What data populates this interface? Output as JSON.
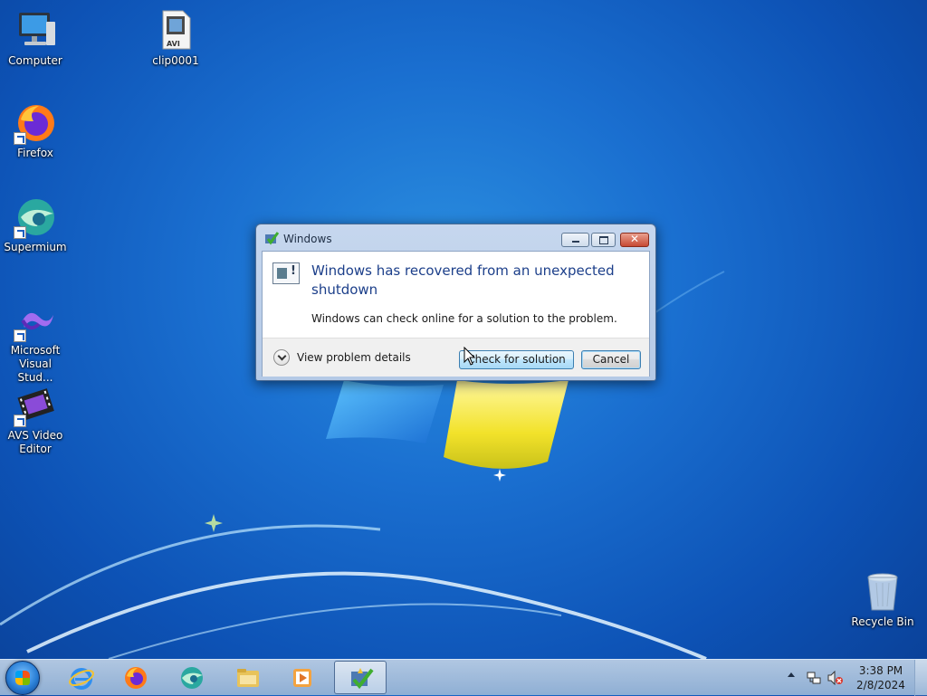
{
  "desktop": {
    "icons": [
      {
        "label": "Computer",
        "icon": "computer-icon"
      },
      {
        "label": "clip0001",
        "icon": "avi-file-icon",
        "badge": "AVI"
      },
      {
        "label": "Firefox",
        "icon": "firefox-icon"
      },
      {
        "label": "Supermium",
        "icon": "supermium-icon"
      },
      {
        "label": "Microsoft Visual Stud...",
        "label_line1": "Microsoft",
        "label_line2": "Visual Stud...",
        "icon": "visual-studio-icon"
      },
      {
        "label": "AVS Video Editor",
        "label_line1": "AVS Video",
        "label_line2": "Editor",
        "icon": "avs-video-editor-icon"
      },
      {
        "label": "Recycle Bin",
        "icon": "recycle-bin-icon"
      }
    ]
  },
  "dialog": {
    "title": "Windows",
    "heading": "Windows has recovered from an unexpected shutdown",
    "message": "Windows can check online for a solution to the problem.",
    "details_label": "View problem details",
    "check_button": "Check for solution",
    "cancel_button": "Cancel"
  },
  "taskbar": {
    "pinned": [
      "start-orb-icon",
      "internet-explorer-icon",
      "firefox-icon",
      "supermium-icon",
      "file-explorer-icon",
      "media-player-icon",
      "problem-reports-icon"
    ],
    "clock_time": "3:38 PM",
    "clock_date": "2/8/2024"
  },
  "colors": {
    "desktop_blue": "#1a6fd0",
    "dialog_heading": "#1c3f8a",
    "close_red": "#c74a33"
  }
}
